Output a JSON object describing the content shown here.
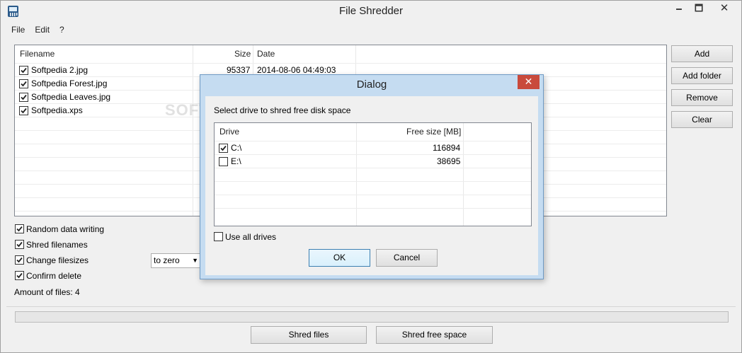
{
  "window": {
    "title": "File Shredder",
    "min_glyph": "🗕",
    "max_glyph": "🗖",
    "close_glyph": "✕"
  },
  "menu": [
    "File",
    "Edit",
    "?"
  ],
  "file_list": {
    "columns": [
      "Filename",
      "Size",
      "Date"
    ],
    "rows": [
      {
        "checked": true,
        "name": "Softpedia 2.jpg",
        "size": "95337",
        "date": "2014-08-06 04:49:03"
      },
      {
        "checked": true,
        "name": "Softpedia Forest.jpg",
        "size": "",
        "date": ""
      },
      {
        "checked": true,
        "name": "Softpedia Leaves.jpg",
        "size": "",
        "date": ""
      },
      {
        "checked": true,
        "name": "Softpedia.xps",
        "size": "",
        "date": ""
      }
    ]
  },
  "side_buttons": [
    "Add",
    "Add folder",
    "Remove",
    "Clear"
  ],
  "options": [
    {
      "checked": true,
      "label": "Random data writing"
    },
    {
      "checked": true,
      "label": "Shred filenames"
    },
    {
      "checked": true,
      "label": "Change filesizes"
    },
    {
      "checked": true,
      "label": "Confirm delete"
    }
  ],
  "filesize_select": {
    "value": "to zero"
  },
  "amount_label": "Amount of files: 4",
  "progress": 0,
  "bottom_buttons": [
    "Shred files",
    "Shred free space"
  ],
  "watermark": "SOFTPEDIA",
  "dialog": {
    "title": "Dialog",
    "close_glyph": "✕",
    "prompt": "Select drive to shred free disk space",
    "columns": [
      "Drive",
      "Free size [MB]"
    ],
    "drives": [
      {
        "checked": true,
        "drive": "C:\\",
        "free": "116894"
      },
      {
        "checked": false,
        "drive": "E:\\",
        "free": "38695"
      }
    ],
    "use_all": {
      "checked": false,
      "label": "Use all drives"
    },
    "ok_label": "OK",
    "cancel_label": "Cancel"
  },
  "colors": {
    "dialog_frame": "#c5dcf1",
    "close_red": "#c94a3c",
    "primary_border": "#3c7fb1"
  }
}
